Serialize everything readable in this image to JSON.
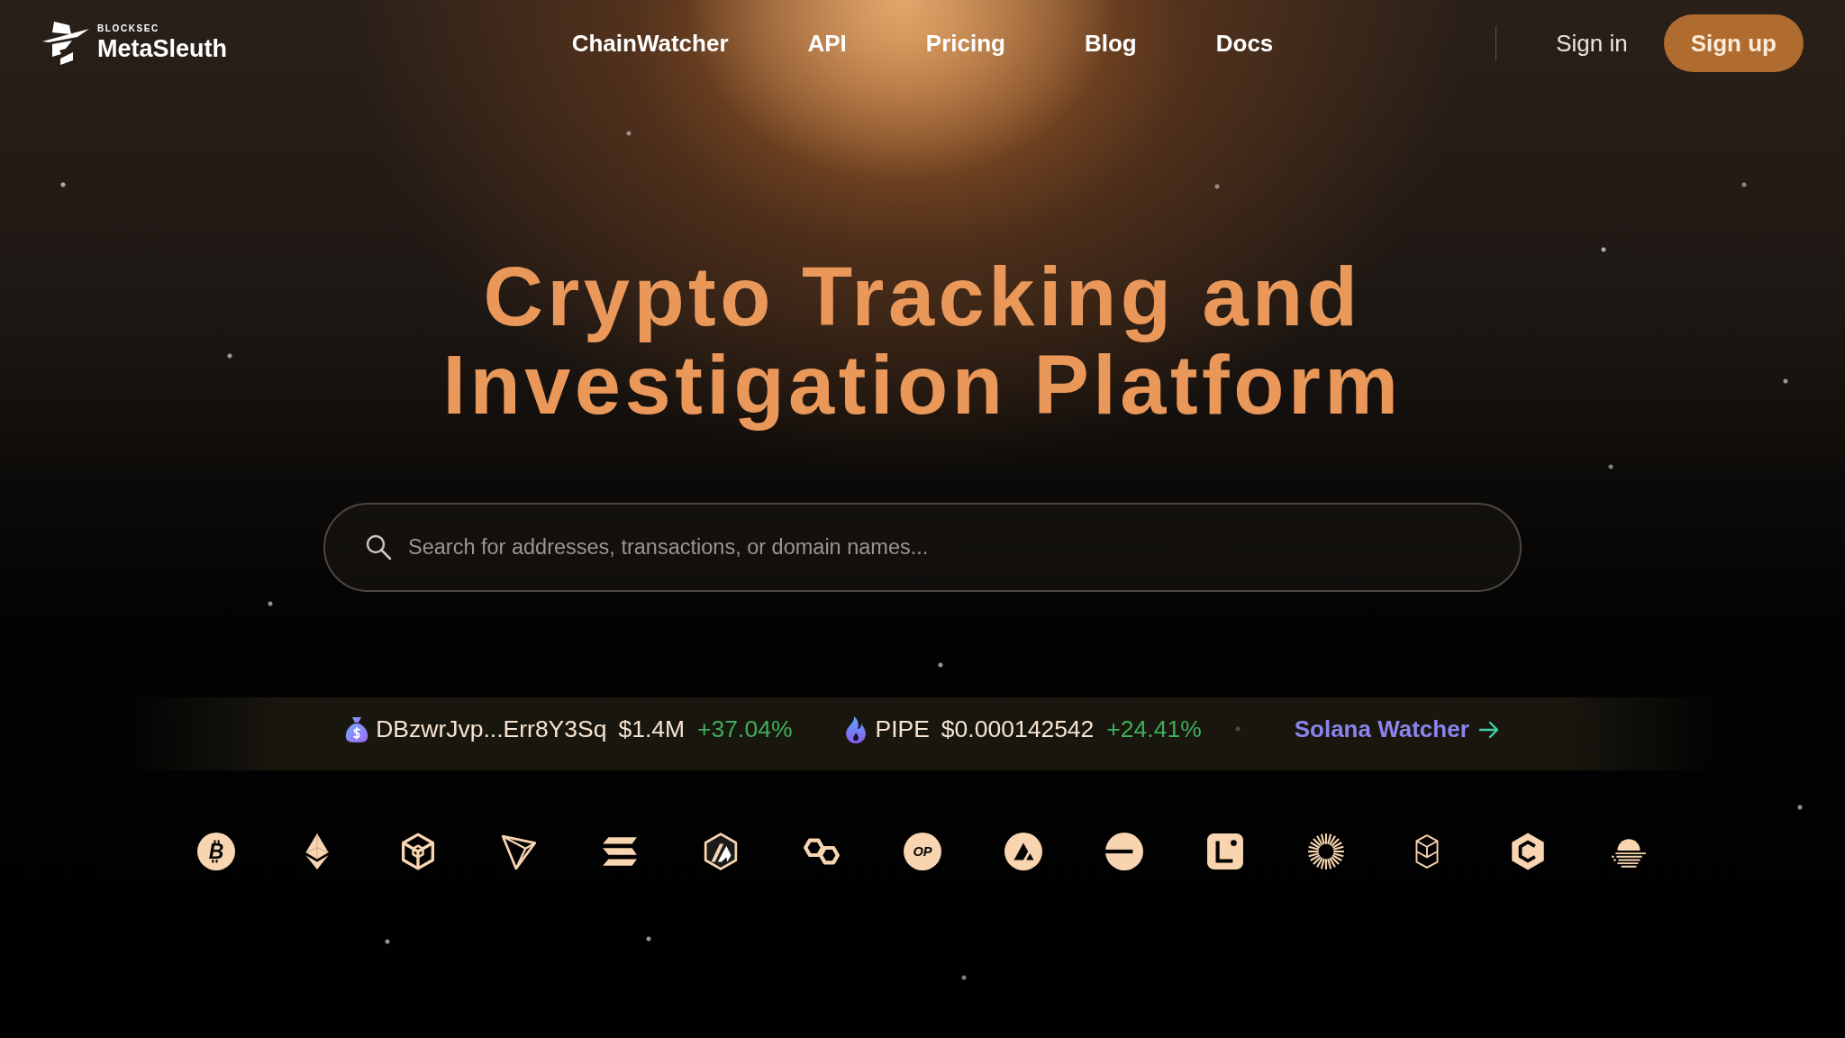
{
  "header": {
    "logo": {
      "overline": "BLOCKSEC",
      "name": "MetaSleuth"
    },
    "nav": [
      "ChainWatcher",
      "API",
      "Pricing",
      "Blog",
      "Docs"
    ],
    "sign_in": "Sign in",
    "sign_up": "Sign up"
  },
  "hero": {
    "title": "Crypto Tracking and Investigation Platform",
    "search": {
      "placeholder": "Search for addresses, transactions, or domain names..."
    }
  },
  "ticker": {
    "items": [
      {
        "kind": "bag",
        "name": "DBzwrJvp...Err8Y3Sq",
        "price": "$1.4M",
        "change": "+37.04%",
        "rising": true
      },
      {
        "kind": "flame",
        "name": "PIPE",
        "price": "$0.000142542",
        "change": "+24.41%",
        "rising": true
      }
    ],
    "link": "Solana Watcher"
  },
  "chains": [
    {
      "kind": "bitcoin",
      "label": "B"
    },
    {
      "kind": "ethereum"
    },
    {
      "kind": "cube"
    },
    {
      "kind": "triangle"
    },
    {
      "kind": "stripes"
    },
    {
      "kind": "shield"
    },
    {
      "kind": "links"
    },
    {
      "kind": "opcoin",
      "label": "OP"
    },
    {
      "kind": "peak"
    },
    {
      "kind": "dash"
    },
    {
      "kind": "corner"
    },
    {
      "kind": "sunburst"
    },
    {
      "kind": "prism"
    },
    {
      "kind": "hexagon"
    },
    {
      "kind": "sunset"
    }
  ]
}
